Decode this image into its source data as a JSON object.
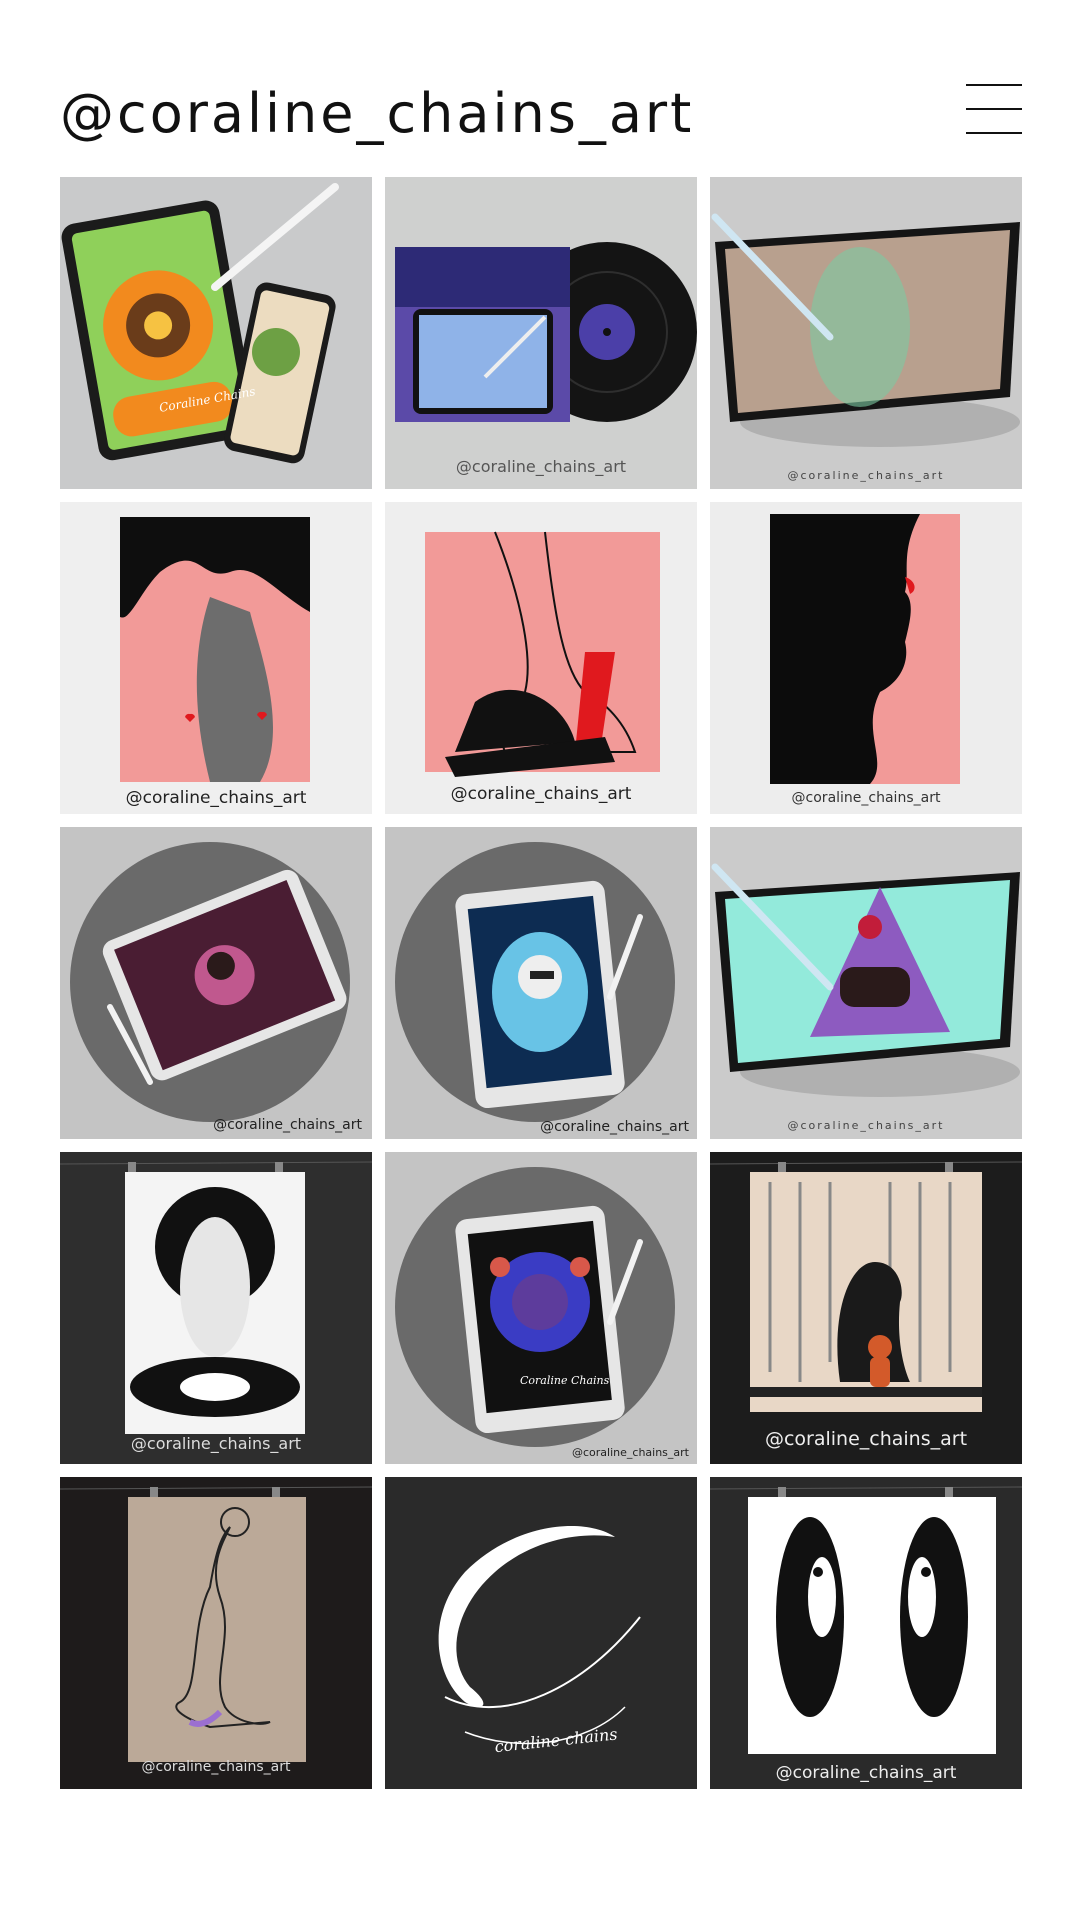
{
  "header": {
    "title": "@coraline_chains_art"
  },
  "icons": {
    "menu": "hamburger-menu-icon"
  },
  "watermark": "@coraline_chains_art",
  "tiles": [
    {
      "name": "post-mandala-tablet",
      "label": "Coraline Chains"
    },
    {
      "name": "post-vinyl-album"
    },
    {
      "name": "post-alien-figure-tablet"
    },
    {
      "name": "post-pink-nude-canvas"
    },
    {
      "name": "post-pink-seated-canvas"
    },
    {
      "name": "post-pink-profile-canvas"
    },
    {
      "name": "post-fairy-ipad"
    },
    {
      "name": "post-portrait-ipad"
    },
    {
      "name": "post-centaur-tablet"
    },
    {
      "name": "post-moon-woman-print"
    },
    {
      "name": "post-kaleidoscope-ipad",
      "label": "Coraline Chains"
    },
    {
      "name": "post-rain-figure-print"
    },
    {
      "name": "post-sketch-nude-print"
    },
    {
      "name": "post-logo-c",
      "label": "coraline chains"
    },
    {
      "name": "post-mirror-faces-print"
    }
  ],
  "colors": {
    "grey_bg": "#c9cacb",
    "pink": "#f29a98",
    "dark_bg": "#2a2a2a",
    "accent_red": "#e0191e"
  }
}
